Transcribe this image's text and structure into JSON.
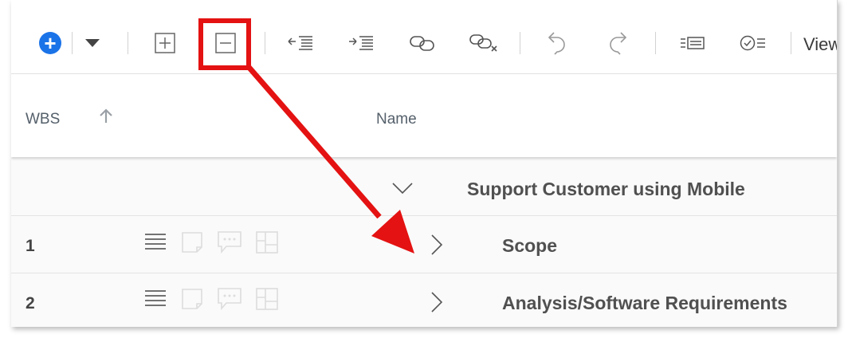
{
  "toolbar": {
    "add_icon": "plus-circle-icon",
    "view_label": "View",
    "icons": [
      "plus-circle-icon",
      "caret-down-icon",
      "expand-all-icon",
      "collapse-all-icon",
      "outdent-icon",
      "indent-icon",
      "link-icon",
      "unlink-icon",
      "undo-icon",
      "redo-icon",
      "details-icon",
      "checklist-icon"
    ]
  },
  "header": {
    "wbs_label": "WBS",
    "name_label": "Name",
    "sort_icon": "sort-up-arrow-icon"
  },
  "rows": [
    {
      "wbs": "",
      "name": "Support Customer using Mobile",
      "expanded": true
    },
    {
      "wbs": "1",
      "name": "Scope",
      "expanded": false
    },
    {
      "wbs": "2",
      "name": "Analysis/Software Requirements",
      "expanded": false
    }
  ],
  "annotation": {
    "color": "#e41212"
  },
  "colors": {
    "accent": "#1b73e8",
    "annotation": "#e41212"
  }
}
